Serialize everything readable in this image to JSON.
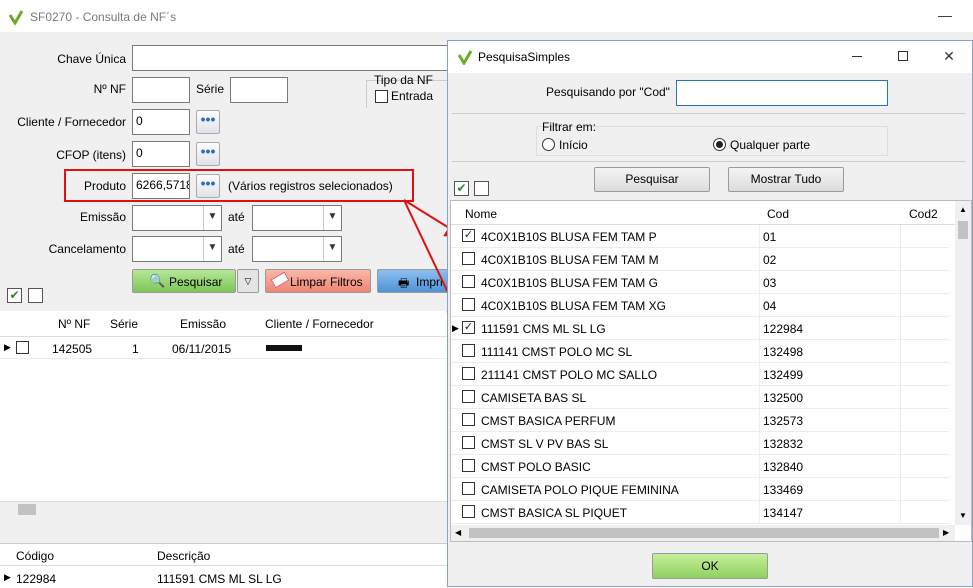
{
  "main_window": {
    "title": "SF0270 - Consulta de NF´s",
    "minimize": "—",
    "filters": {
      "chave_unica_label": "Chave Única",
      "chave_unica_value": "",
      "nf_label": "Nº NF",
      "nf_value": "",
      "serie_label": "Série",
      "serie_value": "",
      "tipo_nf_label": "Tipo da NF",
      "entrada_label": "Entrada",
      "cliente_label": "Cliente / Fornecedor",
      "cliente_value": "0",
      "cfop_label": "CFOP (itens)",
      "cfop_value": "0",
      "produto_label": "Produto",
      "produto_value": "6266,5718",
      "produto_note": "(Vários registros selecionados)",
      "emissao_label": "Emissão",
      "ate_label": "até",
      "cancelamento_label": "Cancelamento",
      "ate2_label": "até",
      "dots": "•••"
    },
    "buttons": {
      "pesquisar": "Pesquisar",
      "limpar": "Limpar Filtros",
      "imprimir": "Impri"
    },
    "grid": {
      "headers": [
        "Nº NF",
        "Série",
        "Emissão",
        "Cliente / Fornecedor"
      ],
      "rows": [
        {
          "nf": "142505",
          "serie": "1",
          "emissao": "06/11/2015",
          "cliente": ""
        }
      ]
    },
    "items_grid": {
      "headers": [
        "Código",
        "Descrição"
      ],
      "rows": [
        {
          "codigo": "122984",
          "descricao": "111591 CMS ML SL LG"
        }
      ]
    }
  },
  "dialog": {
    "title": "PesquisaSimples",
    "close": "✕",
    "pesquisando_label": "Pesquisando por \"Cod\"",
    "search_value": "",
    "filtrar_label": "Filtrar em:",
    "radio_inicio": "Início",
    "radio_qualquer": "Qualquer parte",
    "btn_pesquisar": "Pesquisar",
    "btn_mostrar": "Mostrar Tudo",
    "btn_ok": "OK",
    "headers": [
      "Nome",
      "Cod",
      "Cod2"
    ],
    "rows": [
      {
        "nome": "4C0X1B10S BLUSA FEM TAM P",
        "cod": "01",
        "checked": true
      },
      {
        "nome": "4C0X1B10S BLUSA FEM TAM M",
        "cod": "02",
        "checked": false
      },
      {
        "nome": "4C0X1B10S BLUSA FEM TAM G",
        "cod": "03",
        "checked": false
      },
      {
        "nome": "4C0X1B10S BLUSA FEM TAM XG",
        "cod": "04",
        "checked": false
      },
      {
        "nome": "111591 CMS ML SL LG",
        "cod": "122984",
        "checked": true
      },
      {
        "nome": "111141 CMST POLO MC SL",
        "cod": "132498",
        "checked": false
      },
      {
        "nome": "211141 CMST POLO MC SALLO",
        "cod": "132499",
        "checked": false
      },
      {
        "nome": "CAMISETA BAS SL",
        "cod": "132500",
        "checked": false
      },
      {
        "nome": "CMST BASICA  PERFUM",
        "cod": "132573",
        "checked": false
      },
      {
        "nome": "CMST SL V PV BAS SL",
        "cod": "132832",
        "checked": false
      },
      {
        "nome": "CMST POLO BASIC",
        "cod": "132840",
        "checked": false
      },
      {
        "nome": "CAMISETA POLO PIQUE FEMININA",
        "cod": "133469",
        "checked": false
      },
      {
        "nome": "CMST BASICA SL PIQUET",
        "cod": "134147",
        "checked": false
      }
    ]
  },
  "colors": {
    "annotation_red": "#e01010",
    "green_button": "#8fd16a",
    "red_button": "#f08a7a",
    "blue_button": "#5b9bd5"
  }
}
